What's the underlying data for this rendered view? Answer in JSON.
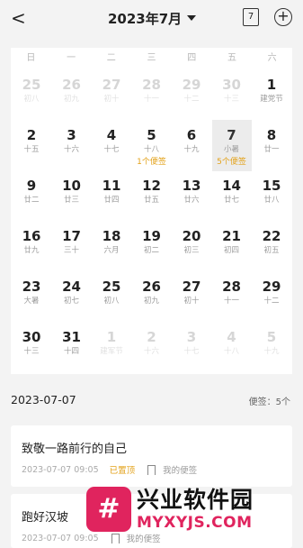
{
  "header": {
    "back_label": "<",
    "title": "2023年7月",
    "today_icon_text": "7",
    "add_icon": "plus-circle-icon"
  },
  "calendar": {
    "weekdays": [
      "日",
      "一",
      "二",
      "三",
      "四",
      "五",
      "六"
    ],
    "rows": [
      [
        {
          "d": "25",
          "l": "初八",
          "muted": true
        },
        {
          "d": "26",
          "l": "初九",
          "muted": true
        },
        {
          "d": "27",
          "l": "初十",
          "muted": true
        },
        {
          "d": "28",
          "l": "十一",
          "muted": true
        },
        {
          "d": "29",
          "l": "十二",
          "muted": true
        },
        {
          "d": "30",
          "l": "十三",
          "muted": true
        },
        {
          "d": "1",
          "l": "建党节",
          "muted": false
        }
      ],
      [
        {
          "d": "2",
          "l": "十五"
        },
        {
          "d": "3",
          "l": "十六"
        },
        {
          "d": "4",
          "l": "十七"
        },
        {
          "d": "5",
          "l": "十八",
          "note": "1个便签"
        },
        {
          "d": "6",
          "l": "十九"
        },
        {
          "d": "7",
          "l": "小暑",
          "note": "5个便签",
          "selected": true
        },
        {
          "d": "8",
          "l": "廿一"
        }
      ],
      [
        {
          "d": "9",
          "l": "廿二"
        },
        {
          "d": "10",
          "l": "廿三"
        },
        {
          "d": "11",
          "l": "廿四"
        },
        {
          "d": "12",
          "l": "廿五"
        },
        {
          "d": "13",
          "l": "廿六"
        },
        {
          "d": "14",
          "l": "廿七"
        },
        {
          "d": "15",
          "l": "廿八"
        }
      ],
      [
        {
          "d": "16",
          "l": "廿九"
        },
        {
          "d": "17",
          "l": "三十"
        },
        {
          "d": "18",
          "l": "六月"
        },
        {
          "d": "19",
          "l": "初二"
        },
        {
          "d": "20",
          "l": "初三"
        },
        {
          "d": "21",
          "l": "初四"
        },
        {
          "d": "22",
          "l": "初五"
        }
      ],
      [
        {
          "d": "23",
          "l": "大暑"
        },
        {
          "d": "24",
          "l": "初七"
        },
        {
          "d": "25",
          "l": "初八"
        },
        {
          "d": "26",
          "l": "初九"
        },
        {
          "d": "27",
          "l": "初十"
        },
        {
          "d": "28",
          "l": "十一"
        },
        {
          "d": "29",
          "l": "十二"
        }
      ],
      [
        {
          "d": "30",
          "l": "十三"
        },
        {
          "d": "31",
          "l": "十四"
        },
        {
          "d": "1",
          "l": "建军节",
          "muted": true
        },
        {
          "d": "2",
          "l": "十六",
          "muted": true
        },
        {
          "d": "3",
          "l": "十七",
          "muted": true
        },
        {
          "d": "4",
          "l": "十八",
          "muted": true
        },
        {
          "d": "5",
          "l": "十九",
          "muted": true
        }
      ]
    ]
  },
  "notes_section": {
    "date": "2023-07-07",
    "count_label": "便签：5个"
  },
  "notes": [
    {
      "title": "致敬一路前行的自己",
      "time": "2023-07-07 09:05",
      "pinned_label": "已置顶",
      "category": "我的便签"
    },
    {
      "title": "跑好汉坡",
      "time": "2023-07-07 09:05",
      "category": "我的便签"
    }
  ],
  "watermark": {
    "logo_char": "#",
    "text": "兴业软件园",
    "url": "MYXYJS.COM"
  },
  "colors": {
    "accent": "#e3a21a",
    "background": "#f3f3f3",
    "selected_cell": "#ececec",
    "watermark_brand": "#e0245e"
  }
}
